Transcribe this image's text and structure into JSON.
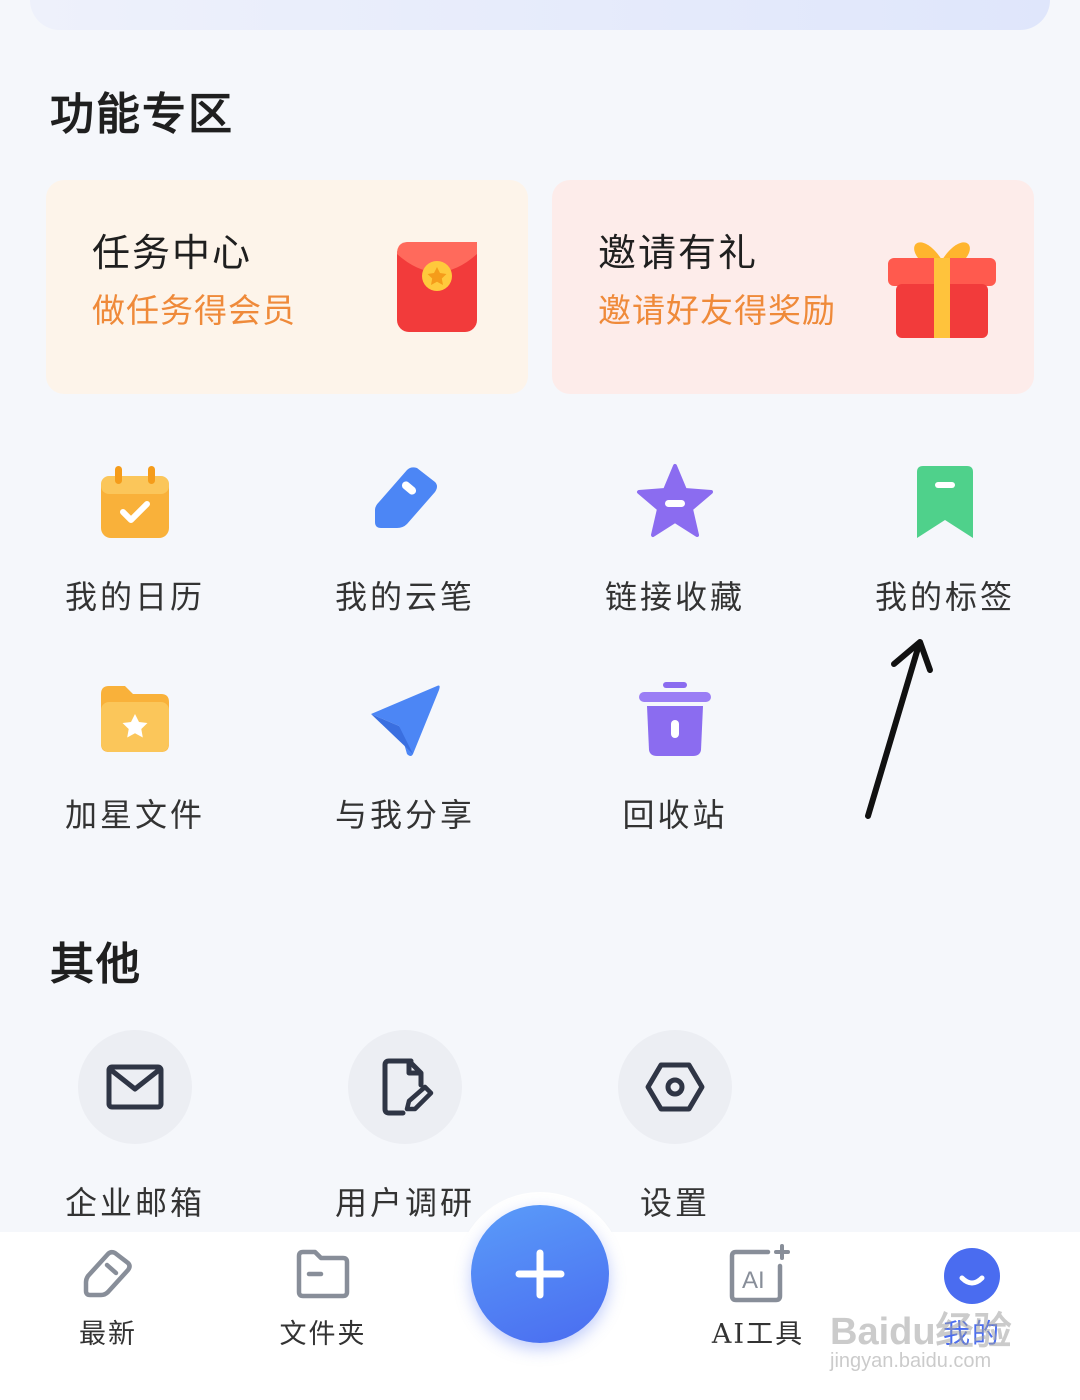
{
  "sections": {
    "features_title": "功能专区",
    "others_title": "其他"
  },
  "promos": [
    {
      "title": "任务中心",
      "subtitle": "做任务得会员",
      "bg": "#fdf4ea",
      "icon": "red-envelope-icon"
    },
    {
      "title": "邀请有礼",
      "subtitle": "邀请好友得奖励",
      "bg": "#fdecea",
      "icon": "gift-box-icon"
    }
  ],
  "features": [
    {
      "label": "我的日历",
      "icon": "calendar-icon",
      "color": "#f9b13a"
    },
    {
      "label": "我的云笔",
      "icon": "tag-pen-icon",
      "color": "#4c86f5"
    },
    {
      "label": "链接收藏",
      "icon": "star-icon",
      "color": "#8b6cf0"
    },
    {
      "label": "我的标签",
      "icon": "bookmark-icon",
      "color": "#4fd18b"
    },
    {
      "label": "加星文件",
      "icon": "starred-folder-icon",
      "color": "#f9b13a"
    },
    {
      "label": "与我分享",
      "icon": "paper-plane-icon",
      "color": "#4c86f5"
    },
    {
      "label": "回收站",
      "icon": "trash-icon",
      "color": "#8b6cf0"
    }
  ],
  "others": [
    {
      "label": "企业邮箱",
      "icon": "mail-icon"
    },
    {
      "label": "用户调研",
      "icon": "document-edit-icon"
    },
    {
      "label": "设置",
      "icon": "settings-icon"
    }
  ],
  "bottom_nav": [
    {
      "label": "最新",
      "icon": "tag-outline-icon"
    },
    {
      "label": "文件夹",
      "icon": "folder-outline-icon"
    },
    {
      "label": "AI工具",
      "icon": "ai-tool-icon"
    },
    {
      "label": "我的",
      "icon": "profile-smile-icon",
      "active": true
    }
  ],
  "fab_icon": "plus-icon",
  "watermark": {
    "brand": "Baidu经验",
    "url": "jingyan.baidu.com"
  }
}
